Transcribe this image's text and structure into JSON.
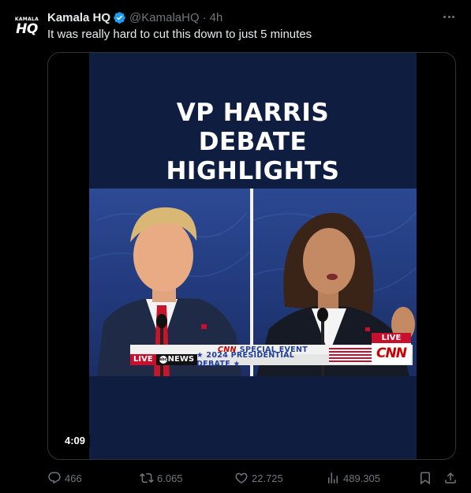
{
  "author": {
    "avatar_small": "KAMALA",
    "avatar_big": "HQ",
    "display_name": "Kamala HQ",
    "handle": "@KamalaHQ",
    "separator": "·",
    "time": "4h"
  },
  "tweet": {
    "text": "It was really hard to cut this down to just 5 minutes"
  },
  "video": {
    "title_lines": [
      "VP HARRIS",
      "DEBATE",
      "HIGHLIGHTS"
    ],
    "lower_third": {
      "live_left": "LIVE",
      "network_left": "NEWS",
      "network_left_logo": "abc",
      "event_brand": "CNN",
      "event_line1": "SPECIAL EVENT",
      "event_line2": "★ 2024 PRESIDENTIAL DEBATE ★",
      "live_right": "LIVE",
      "network_right": "CNN"
    },
    "duration": "4:09"
  },
  "actions": {
    "replies": "466",
    "reposts": "6.065",
    "likes": "22.725",
    "views": "489.305"
  },
  "icons": {
    "verified": "verified-badge-icon",
    "more": "more-dots-icon",
    "reply": "reply-icon",
    "repost": "repost-icon",
    "like": "heart-icon",
    "views": "views-bar-icon",
    "bookmark": "bookmark-icon",
    "share": "share-icon"
  },
  "colors": {
    "background": "#000000",
    "text_primary": "#e7e9ea",
    "text_secondary": "#71767b",
    "verified": "#1d9bf0",
    "video_bg": "#0f1d40",
    "news_red": "#c8102e"
  }
}
